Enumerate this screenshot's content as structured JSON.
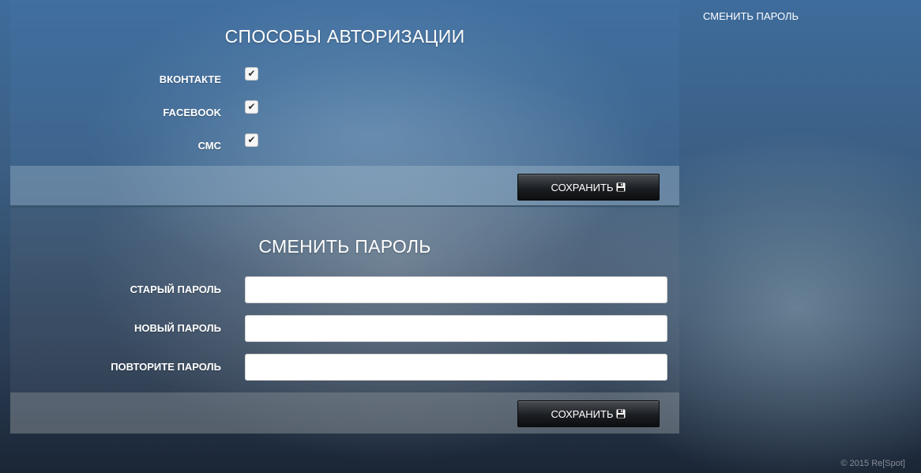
{
  "auth_section": {
    "title": "СПОСОБЫ АВТОРИЗАЦИИ",
    "methods": [
      {
        "label": "ВКОНТАКТЕ",
        "checked": true
      },
      {
        "label": "FACEBOOK",
        "checked": true
      },
      {
        "label": "СМС",
        "checked": true
      }
    ],
    "save_label": "СОХРАНИТЬ"
  },
  "password_section": {
    "title": "СМЕНИТЬ ПАРОЛЬ",
    "fields": [
      {
        "label": "СТАРЫЙ ПАРОЛЬ",
        "value": ""
      },
      {
        "label": "НОВЫЙ ПАРОЛЬ",
        "value": ""
      },
      {
        "label": "ПОВТОРИТЕ ПАРОЛЬ",
        "value": ""
      }
    ],
    "save_label": "СОХРАНИТЬ"
  },
  "sidebar": {
    "link_label": "СМЕНИТЬ ПАРОЛЬ"
  },
  "footer": {
    "copyright": "© 2015 Re[Spot]"
  },
  "icons": {
    "checkmark": "check-icon",
    "save": "floppy-disk-icon"
  }
}
